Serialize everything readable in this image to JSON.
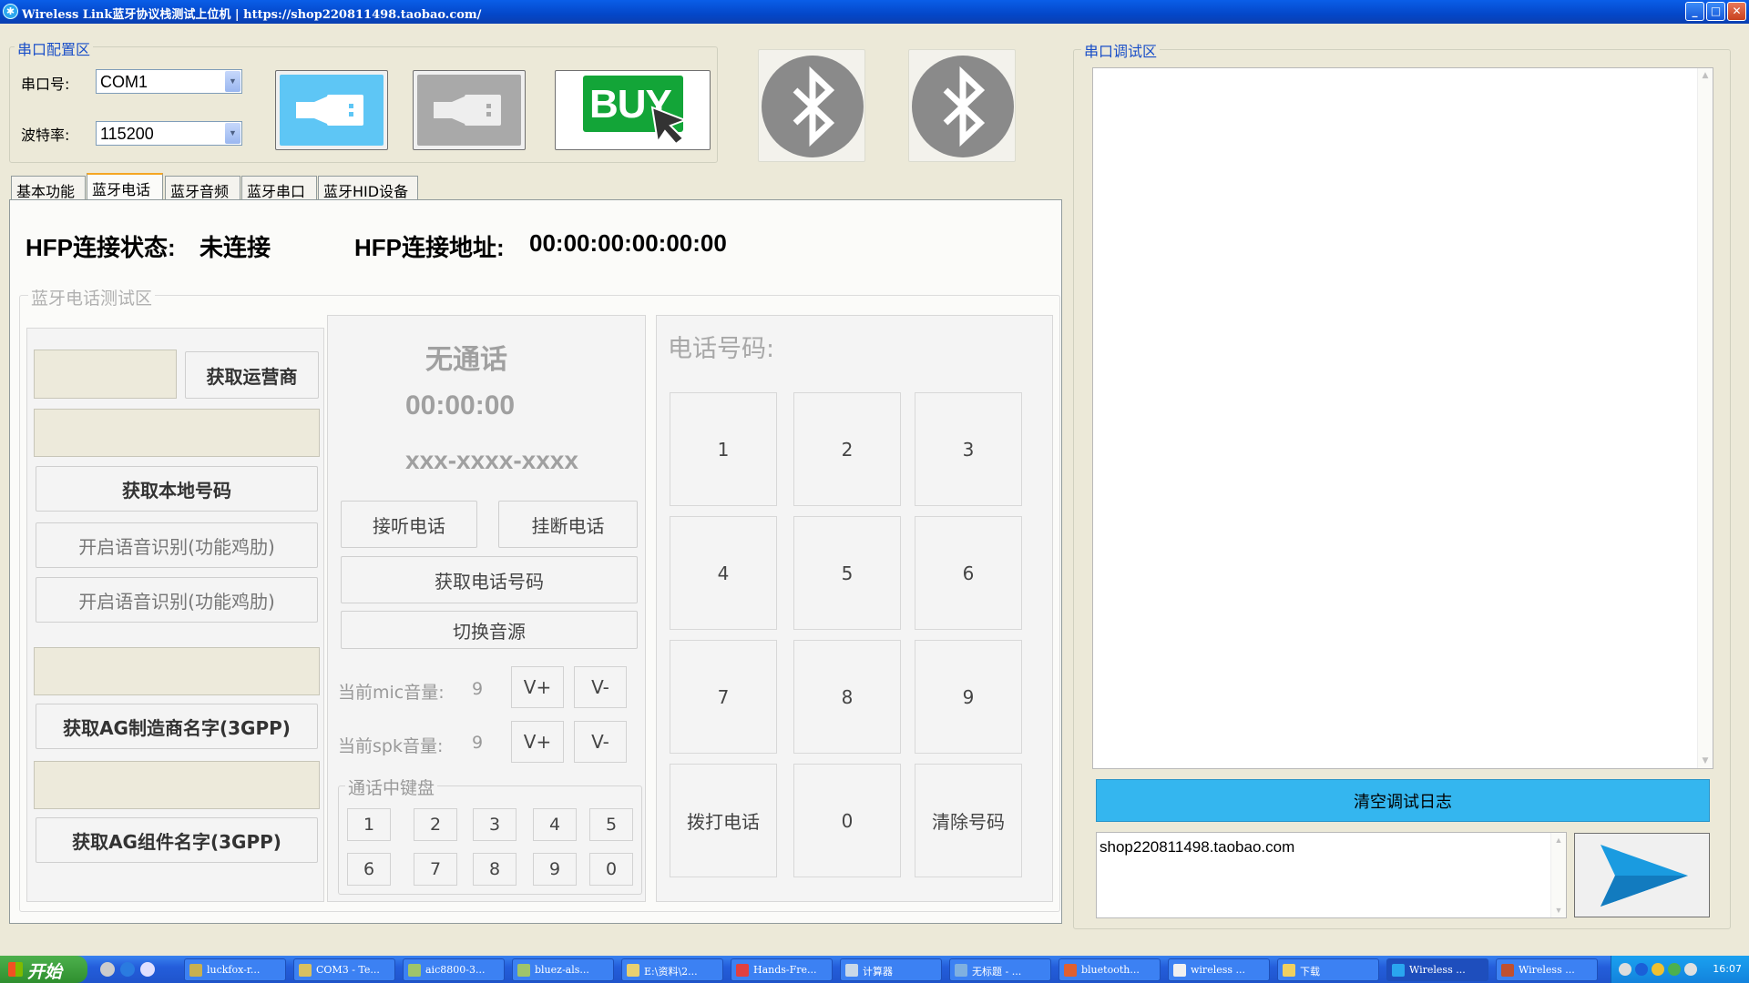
{
  "window": {
    "title": "Wireless Link蓝牙协议栈测试上位机 | https://shop220811498.taobao.com/",
    "min_symbol": "_",
    "max_symbol": "□",
    "close_symbol": "✕"
  },
  "serial_config": {
    "title": "串口配置区",
    "port_label": "串口号:",
    "port_value": "COM1",
    "baud_label": "波特率:",
    "baud_value": "115200",
    "buy_label": "BUY"
  },
  "tabs": [
    {
      "label": "基本功能"
    },
    {
      "label": "蓝牙电话"
    },
    {
      "label": "蓝牙音频"
    },
    {
      "label": "蓝牙串口"
    },
    {
      "label": "蓝牙HID设备"
    }
  ],
  "hfp": {
    "status_label": "HFP连接状态:",
    "status_value": "未连接",
    "address_label": "HFP连接地址:",
    "address_value": "00:00:00:00:00:00"
  },
  "phone_test": {
    "title": "蓝牙电话测试区",
    "left": {
      "get_operator": "获取运营商",
      "get_local_number": "获取本地号码",
      "voice_recog_1": "开启语音识别(功能鸡肋)",
      "voice_recog_2": "开启语音识别(功能鸡肋)",
      "get_ag_manufacturer": "获取AG制造商名字(3GPP)",
      "get_ag_component": "获取AG组件名字(3GPP)"
    },
    "middle": {
      "call_status": "无通话",
      "call_time": "00:00:00",
      "call_number": "xxx-xxxx-xxxx",
      "answer": "接听电话",
      "hangup": "挂断电话",
      "get_phone_number": "获取电话号码",
      "switch_audio": "切换音源",
      "mic_label": "当前mic音量:",
      "mic_value": "9",
      "spk_label": "当前spk音量:",
      "spk_value": "9",
      "vol_up": "V+",
      "vol_down": "V-",
      "in_call_keypad_title": "通话中键盘",
      "in_call_keys": [
        "1",
        "2",
        "3",
        "4",
        "5",
        "6",
        "7",
        "8",
        "9",
        "0"
      ]
    },
    "right": {
      "phone_label": "电话号码:",
      "keys": [
        "1",
        "2",
        "3",
        "4",
        "5",
        "6",
        "7",
        "8",
        "9"
      ],
      "dial": "拨打电话",
      "zero": "0",
      "clear": "清除号码"
    }
  },
  "debug": {
    "title": "串口调试区",
    "clear_log": "清空调试日志",
    "input_value": "shop220811498.taobao.com"
  },
  "taskbar": {
    "start": "开始",
    "tasks": [
      {
        "label": "luckfox-r...",
        "color": "#c8b050"
      },
      {
        "label": "COM3 - Te...",
        "color": "#d8c060"
      },
      {
        "label": "aic8800-3...",
        "color": "#9fc46a"
      },
      {
        "label": "bluez-als...",
        "color": "#9fc46a"
      },
      {
        "label": "E:\\资料\\2...",
        "color": "#e8d070"
      },
      {
        "label": "Hands-Fre...",
        "color": "#e04040"
      },
      {
        "label": "计算器",
        "color": "#c8d8e8"
      },
      {
        "label": "无标题 - ...",
        "color": "#7fb0e0"
      },
      {
        "label": "bluetooth...",
        "color": "#e06030"
      },
      {
        "label": "wireless ...",
        "color": "#f0f0f0"
      },
      {
        "label": "下载",
        "color": "#f0d060"
      },
      {
        "label": "Wireless ...",
        "color": "#2aa6ef"
      },
      {
        "label": "Wireless ...",
        "color": "#c05030"
      }
    ],
    "clock": "16:07"
  }
}
